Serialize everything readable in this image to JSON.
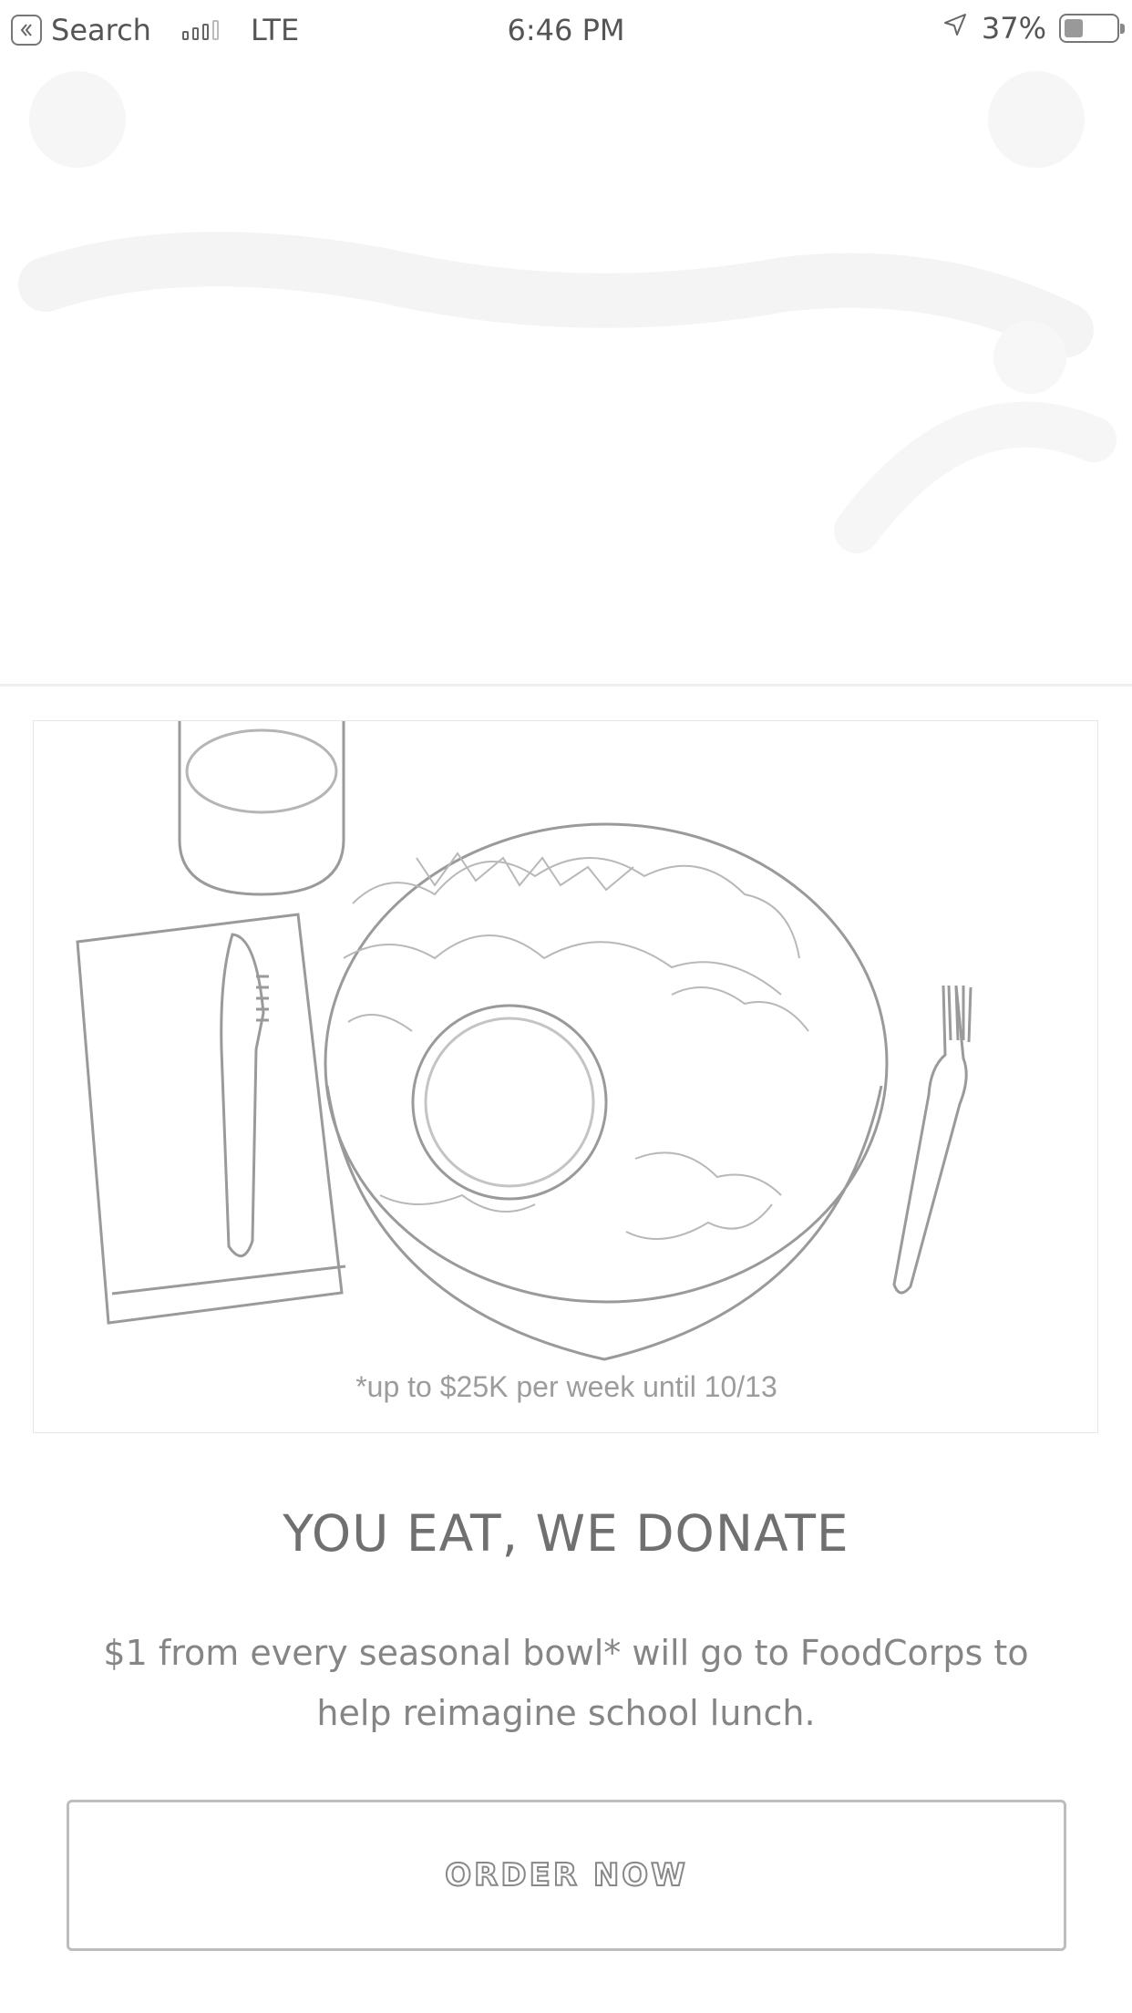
{
  "status_bar": {
    "back_app": "Search",
    "network": "LTE",
    "time": "6:46 PM",
    "battery_percent": "37%",
    "battery_level": 0.37
  },
  "promo": {
    "footnote": "*up to $25K per week until 10/13",
    "headline": "YOU EAT, WE DONATE",
    "description": "$1 from every seasonal bowl* will go to FoodCorps to help reimagine school lunch.",
    "cta_label": "ORDER NOW"
  }
}
